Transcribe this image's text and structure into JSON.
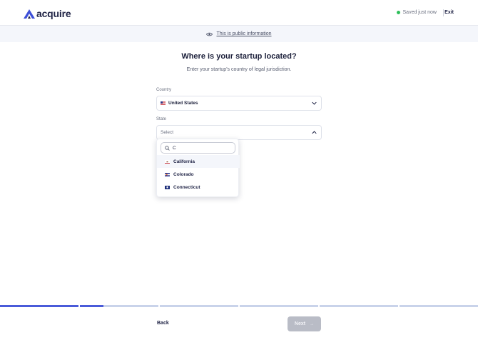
{
  "header": {
    "logo_text": "acquire",
    "saved_text": "Saved just now",
    "exit_label": "Exit",
    "saved_dot_color": "#2fbf5b"
  },
  "public_bar": {
    "icon": "eye-icon",
    "link_text": "This is public information"
  },
  "main": {
    "title": "Where is your startup located?",
    "subtitle": "Enter your startup's country of legal jurisdiction."
  },
  "country": {
    "label": "Country",
    "value": "United States",
    "flag": "us-flag-icon"
  },
  "state": {
    "label": "State",
    "placeholder": "Select",
    "expanded": true
  },
  "dropdown": {
    "search_value": "C",
    "options": [
      {
        "label": "California",
        "flag": "california-flag-icon",
        "highlighted": true
      },
      {
        "label": "Colorado",
        "flag": "colorado-flag-icon",
        "highlighted": false
      },
      {
        "label": "Connecticut",
        "flag": "connecticut-flag-icon",
        "highlighted": false
      }
    ]
  },
  "progress": {
    "completed_fraction": 0.216,
    "accent_color": "#4a5bd9",
    "track_color": "#c9d3ea"
  },
  "footer": {
    "back_label": "Back",
    "next_label": "Next",
    "next_arrow": "→",
    "next_disabled": true
  }
}
